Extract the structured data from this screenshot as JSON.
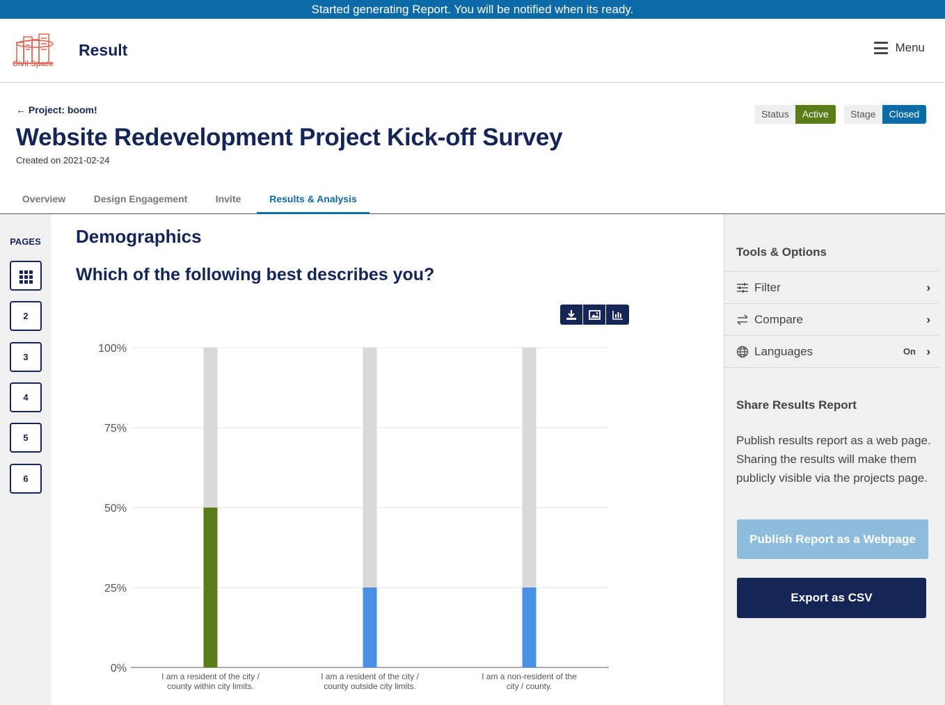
{
  "banner": {
    "text": "Started generating Report. You will be notified when its ready."
  },
  "header": {
    "logo_text": "Civil Space",
    "page_label": "Result",
    "menu_label": "Menu"
  },
  "project": {
    "back_link": "Project: boom!",
    "title": "Website Redevelopment Project Kick-off Survey",
    "created": "Created on 2021-02-24",
    "status_label": "Status",
    "status_value": "Active",
    "stage_label": "Stage",
    "stage_value": "Closed"
  },
  "tabs": [
    {
      "label": "Overview",
      "active": false
    },
    {
      "label": "Design Engagement",
      "active": false
    },
    {
      "label": "Invite",
      "active": false
    },
    {
      "label": "Results & Analysis",
      "active": true
    }
  ],
  "pages_nav": {
    "label": "PAGES",
    "pages": [
      "2",
      "3",
      "4",
      "5",
      "6"
    ]
  },
  "main": {
    "section_title": "Demographics",
    "question": "Which of the following best describes you?"
  },
  "chart_data": {
    "type": "bar",
    "stacked_to_100": true,
    "categories": [
      "I am a resident of the city / county within city limits.",
      "I am a resident of the city / county outside city limits.",
      "I am a non-resident of the city / county."
    ],
    "category_label_lines": [
      [
        "I am a resident of the city /",
        "county within city limits."
      ],
      [
        "I am a resident of the city /",
        "county outside city limits."
      ],
      [
        "I am a non-resident of the",
        "city / county."
      ]
    ],
    "values": [
      50,
      25,
      25
    ],
    "bar_colors": [
      "#5a7c16",
      "#4a90e2",
      "#4a90e2"
    ],
    "remainder_color": "#d9d9d9",
    "yticks": [
      "100%",
      "75%",
      "50%",
      "25%",
      "0%"
    ],
    "ylim": [
      0,
      100
    ],
    "grid": true
  },
  "tools": {
    "title": "Tools & Options",
    "options": [
      {
        "label": "Filter",
        "icon": "sliders-icon",
        "badge": ""
      },
      {
        "label": "Compare",
        "icon": "arrows-exchange-icon",
        "badge": ""
      },
      {
        "label": "Languages",
        "icon": "globe-icon",
        "badge": "On"
      }
    ]
  },
  "share": {
    "title": "Share Results Report",
    "description": "Publish results report as a web page. Sharing the results will make them publicly visible via the projects page.",
    "publish_button": "Publish Report as a Webpage",
    "export_button": "Export as CSV"
  },
  "colors": {
    "brand": "#142556",
    "accent": "#0c6aa6",
    "active": "#5a7c16",
    "closed": "#0c6aa6"
  }
}
